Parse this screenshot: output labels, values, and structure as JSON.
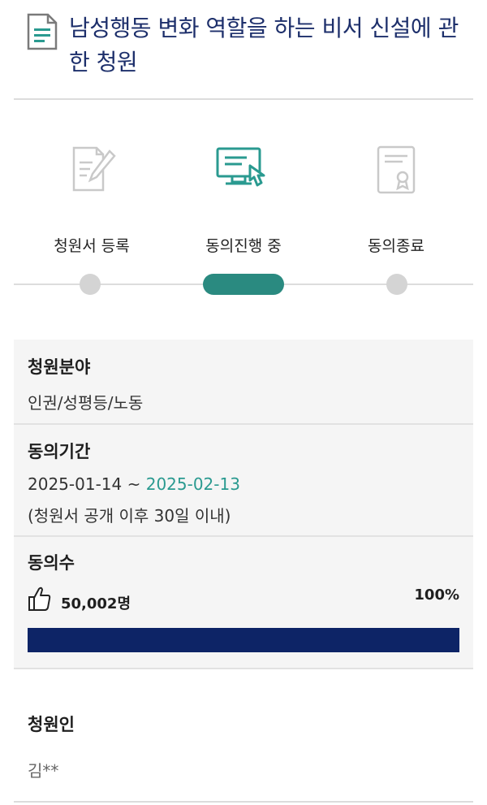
{
  "header": {
    "title": "남성행동 변화 역할을 하는 비서 신설에 관한 청원",
    "icon": "document-icon"
  },
  "progress": {
    "steps": [
      {
        "label": "청원서 등록",
        "icon": "document-edit-icon",
        "state": "done"
      },
      {
        "label": "동의진행 중",
        "icon": "computer-click-icon",
        "state": "active"
      },
      {
        "label": "동의종료",
        "icon": "certificate-icon",
        "state": "pending"
      }
    ],
    "active_color": "#2a8a80"
  },
  "details": {
    "field": {
      "label": "청원분야",
      "value": "인권/성평등/노동"
    },
    "period": {
      "label": "동의기간",
      "start": "2025-01-14",
      "separator": " ~ ",
      "end": "2025-02-13",
      "note": "(청원서 공개 이후 30일 이내)"
    },
    "agreements": {
      "label": "동의수",
      "count": "50,002명",
      "percent_text": "100%",
      "fill_fraction": 1.0,
      "bar_color": "#0d2466",
      "icon": "thumbs-up-icon"
    }
  },
  "petitioner": {
    "label": "청원인",
    "value": "김**"
  }
}
